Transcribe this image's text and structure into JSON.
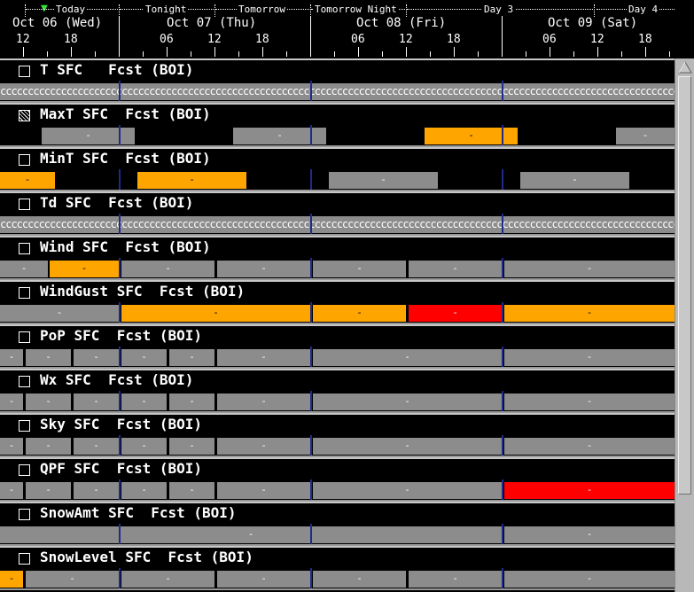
{
  "time_bar": {
    "periods": [
      "Today",
      "Tonight",
      "Tomorrow",
      "Tomorrow Night",
      "Day 3",
      "Day 4"
    ],
    "dates": [
      "Oct 06 (Wed)",
      "Oct 07 (Thu)",
      "Oct 08 (Fri)",
      "Oct 09 (Sat)"
    ],
    "hour_ticks": [
      "12",
      "18",
      "06",
      "12",
      "18",
      "06",
      "12",
      "18",
      "06",
      "12",
      "18"
    ]
  },
  "rows": [
    {
      "title": "T SFC   Fcst (BOI)",
      "checkbox": "unchecked",
      "pattern": "c"
    },
    {
      "title": "MaxT SFC  Fcst (BOI)",
      "checkbox": "partial",
      "blocks": [
        "-",
        "-",
        "-",
        "-"
      ]
    },
    {
      "title": "MinT SFC  Fcst (BOI)",
      "checkbox": "unchecked",
      "blocks": [
        "-",
        "-",
        "-",
        "-"
      ]
    },
    {
      "title": "Td SFC  Fcst (BOI)",
      "checkbox": "unchecked",
      "pattern": "c"
    },
    {
      "title": "Wind SFC  Fcst (BOI)",
      "checkbox": "unchecked",
      "blocks": [
        "-",
        "-",
        "-",
        "-",
        "-",
        "-",
        "-"
      ]
    },
    {
      "title": "WindGust SFC  Fcst (BOI)",
      "checkbox": "unchecked",
      "blocks": [
        "-",
        "-",
        "-",
        "-",
        "-"
      ]
    },
    {
      "title": "PoP SFC  Fcst (BOI)",
      "checkbox": "unchecked",
      "blocks": [
        "-",
        "-",
        "-",
        "-",
        "-",
        "-",
        "-",
        "-"
      ]
    },
    {
      "title": "Wx SFC  Fcst (BOI)",
      "checkbox": "unchecked",
      "blocks": [
        "-",
        "-",
        "-",
        "-",
        "-",
        "-",
        "-",
        "-"
      ]
    },
    {
      "title": "Sky SFC  Fcst (BOI)",
      "checkbox": "unchecked",
      "blocks": [
        "-",
        "-",
        "-",
        "-",
        "-",
        "-",
        "-",
        "-"
      ]
    },
    {
      "title": "QPF SFC  Fcst (BOI)",
      "checkbox": "unchecked",
      "blocks": [
        "-",
        "-",
        "-",
        "-",
        "-",
        "-",
        "-",
        "-"
      ]
    },
    {
      "title": "SnowAmt SFC  Fcst (BOI)",
      "checkbox": "unchecked",
      "blocks": [
        "-",
        "-"
      ]
    },
    {
      "title": "SnowLevel SFC  Fcst (BOI)",
      "checkbox": "unchecked",
      "blocks": [
        "-",
        "-",
        "-",
        "-",
        "-",
        "-",
        "-",
        "-"
      ]
    }
  ],
  "colors": {
    "grid": "#8c8c8c",
    "highlight": "#ffa500",
    "warning": "#ff0000",
    "separator": "#1e2a8c"
  },
  "icons": {
    "now_marker": "green-triangle-icon",
    "scroll_up": "arrow-up-icon"
  }
}
